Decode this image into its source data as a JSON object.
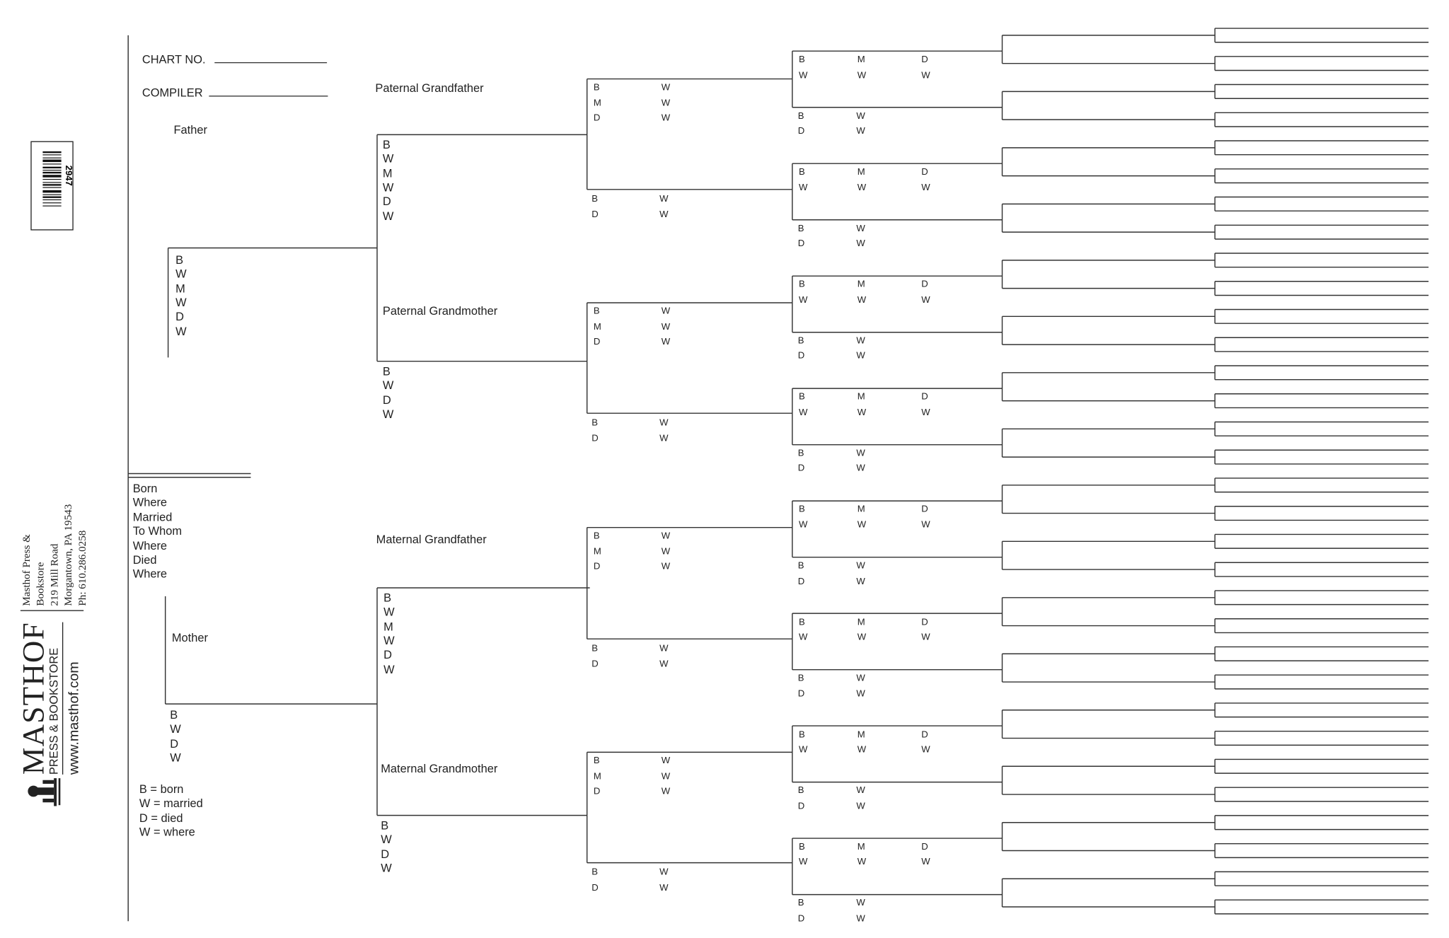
{
  "header": {
    "chart_no_label": "CHART NO.",
    "compiler_label": "COMPILER"
  },
  "barcode": {
    "number": "2947"
  },
  "publisher": {
    "brand": "MASTHOF",
    "tagline": "PRESS & BOOKSTORE",
    "website": "www.masthof.com",
    "address": [
      "Masthof Press & Bookstore",
      "219 Mill Road",
      "Morgantown, PA 19543",
      "Ph: 610.286.0258"
    ]
  },
  "subject": {
    "fields": [
      "Born",
      "Where",
      "Married",
      "To Whom",
      "Where",
      "Died",
      "Where"
    ]
  },
  "father": {
    "label": "Father",
    "fields": [
      "B",
      "W",
      "M",
      "W",
      "D",
      "W"
    ]
  },
  "mother": {
    "label": "Mother",
    "fields": [
      "B",
      "W",
      "D",
      "W"
    ]
  },
  "grandparents": [
    {
      "label": "Paternal Grandfather",
      "fields": [
        "B",
        "W",
        "M",
        "W",
        "D",
        "W"
      ]
    },
    {
      "label": "Paternal Grandmother",
      "fields": [
        "B",
        "W",
        "D",
        "W"
      ]
    },
    {
      "label": "Maternal Grandfather",
      "fields": [
        "B",
        "W",
        "M",
        "W",
        "D",
        "W"
      ]
    },
    {
      "label": "Maternal Grandmother",
      "fields": [
        "B",
        "W",
        "D",
        "W"
      ]
    }
  ],
  "gen3_male_fields": [
    [
      "B",
      "W"
    ],
    [
      "M",
      "W"
    ],
    [
      "D",
      "W"
    ]
  ],
  "gen3_female_fields": [
    [
      "B",
      "W"
    ],
    [
      "D",
      "W"
    ]
  ],
  "gen4_male_fields": [
    [
      "B",
      "M",
      "D"
    ],
    [
      "W",
      "W",
      "W"
    ]
  ],
  "gen4_female_fields": [
    [
      "B",
      "W"
    ],
    [
      "D",
      "W"
    ]
  ],
  "legend": [
    "B = born",
    "W = married",
    "D = died",
    "W = where"
  ]
}
